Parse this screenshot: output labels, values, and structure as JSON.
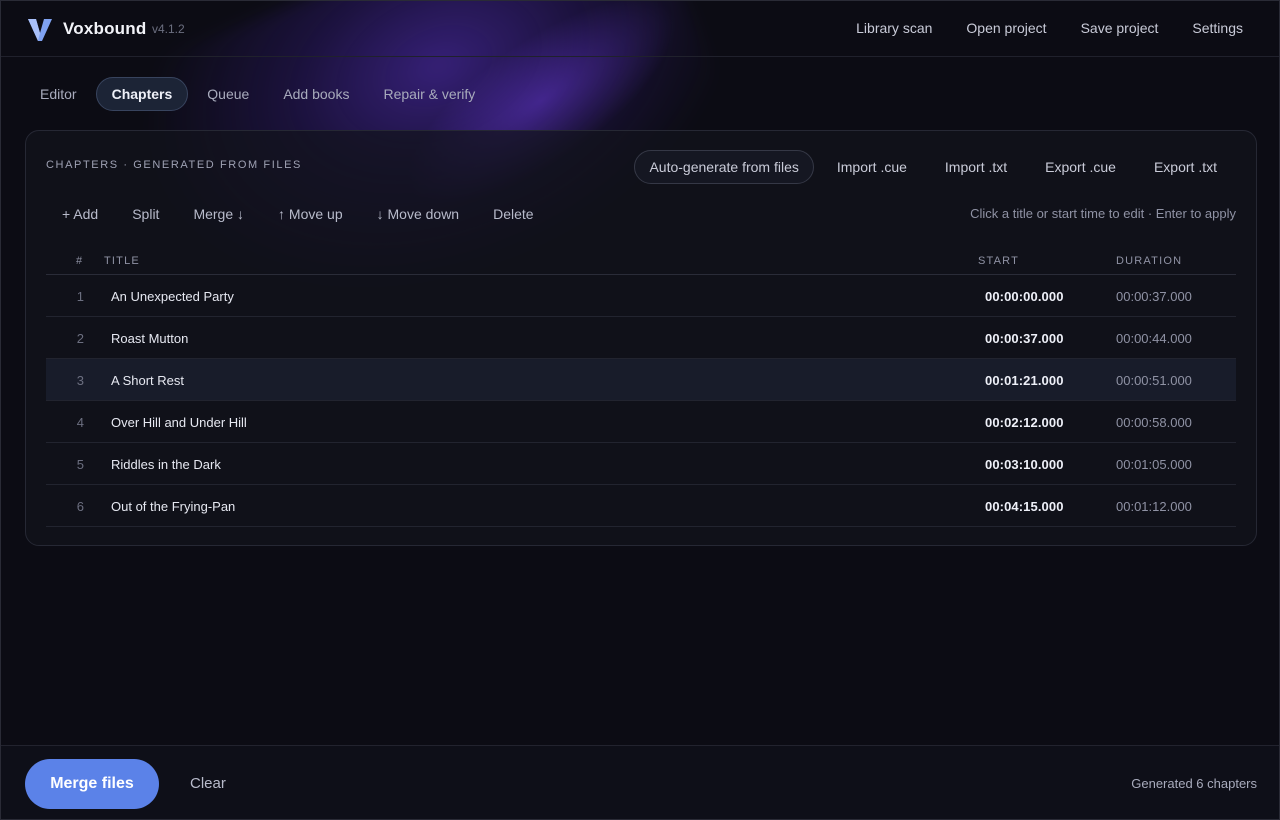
{
  "app": {
    "name": "Voxbound",
    "version": "v4.1.2"
  },
  "header_nav": [
    "Library scan",
    "Open project",
    "Save project",
    "Settings"
  ],
  "tabs": [
    {
      "label": "Editor",
      "active": false
    },
    {
      "label": "Chapters",
      "active": true
    },
    {
      "label": "Queue",
      "active": false
    },
    {
      "label": "Add books",
      "active": false
    },
    {
      "label": "Repair & verify",
      "active": false
    }
  ],
  "panel": {
    "title": "CHAPTERS · GENERATED FROM FILES",
    "actions": [
      "Auto-generate from files",
      "Import .cue",
      "Import .txt",
      "Export .cue",
      "Export .txt"
    ],
    "toolbar": [
      "+ Add",
      "Split",
      "Merge ↓",
      "↑ Move up",
      "↓ Move down",
      "Delete"
    ],
    "hint": "Click a title or start time to edit · Enter to apply"
  },
  "table": {
    "columns": {
      "num": "#",
      "title": "TITLE",
      "start": "START",
      "duration": "DURATION"
    },
    "rows": [
      {
        "num": "1",
        "title": "An Unexpected Party",
        "start": "00:00:00.000",
        "duration": "00:00:37.000"
      },
      {
        "num": "2",
        "title": "Roast Mutton",
        "start": "00:00:37.000",
        "duration": "00:00:44.000"
      },
      {
        "num": "3",
        "title": "A Short Rest",
        "start": "00:01:21.000",
        "duration": "00:00:51.000"
      },
      {
        "num": "4",
        "title": "Over Hill and Under Hill",
        "start": "00:02:12.000",
        "duration": "00:00:58.000"
      },
      {
        "num": "5",
        "title": "Riddles in the Dark",
        "start": "00:03:10.000",
        "duration": "00:01:05.000"
      },
      {
        "num": "6",
        "title": "Out of the Frying-Pan",
        "start": "00:04:15.000",
        "duration": "00:01:12.000"
      }
    ],
    "selected_row": 3
  },
  "footer": {
    "merge_label": "Merge files",
    "clear_label": "Clear",
    "status": "Generated 6 chapters"
  },
  "colors": {
    "accent": "#5b82e8",
    "background": "#0c0c14",
    "glow": "#5830c8"
  }
}
